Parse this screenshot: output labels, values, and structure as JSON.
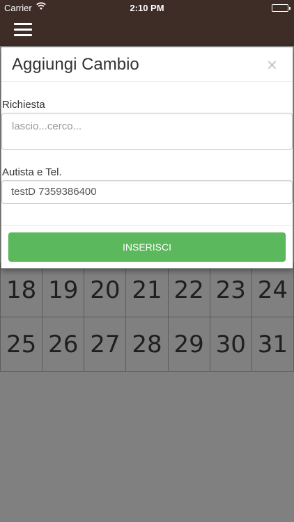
{
  "status_bar": {
    "carrier": "Carrier",
    "time": "2:10 PM",
    "wifi_icon": "wifi-icon",
    "battery_icon": "battery-icon"
  },
  "nav": {
    "menu_icon": "hamburger-menu-icon"
  },
  "modal": {
    "title": "Aggiungi Cambio",
    "close_label": "×",
    "fields": {
      "richiesta": {
        "label": "Richiesta",
        "placeholder": "lascio...cerco...",
        "value": ""
      },
      "autista": {
        "label": "Autista e Tel.",
        "value": "testD 7359386400"
      }
    },
    "submit_label": "INSERISCI",
    "submit_color": "#5cb85c"
  },
  "calendar": {
    "rows": [
      [
        "18",
        "19",
        "20",
        "21",
        "22",
        "23",
        "24"
      ],
      [
        "25",
        "26",
        "27",
        "28",
        "29",
        "30",
        "31"
      ]
    ]
  },
  "colors": {
    "header_bg": "#3e2c26",
    "overlay_bg": "#808080"
  }
}
